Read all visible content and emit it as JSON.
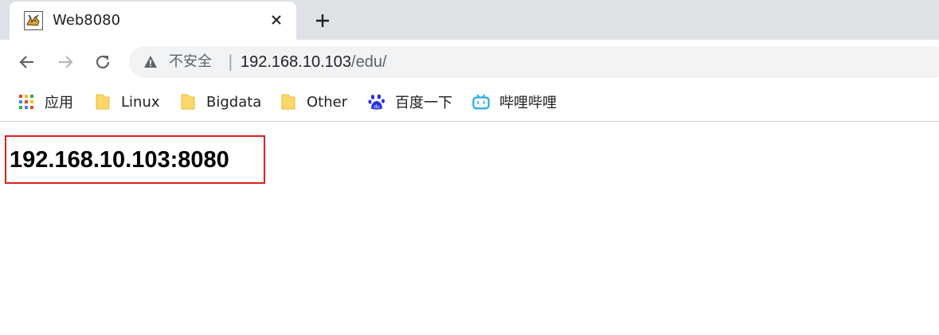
{
  "tab": {
    "title": "Web8080",
    "favicon": "tomcat-icon"
  },
  "new_tab_symbol": "+",
  "toolbar": {
    "security_status": "不安全",
    "separator": "|",
    "url_host": "192.168.10.103",
    "url_path": "/edu/"
  },
  "bookmarks": [
    {
      "label": "应用",
      "icon": "apps-grid-icon"
    },
    {
      "label": "Linux",
      "icon": "folder-icon"
    },
    {
      "label": "Bigdata",
      "icon": "folder-icon"
    },
    {
      "label": "Other",
      "icon": "folder-icon"
    },
    {
      "label": "百度一下",
      "icon": "baidu-paw-icon"
    },
    {
      "label": "哔哩哔哩",
      "icon": "bilibili-icon"
    }
  ],
  "page": {
    "heading": "192.168.10.103:8080"
  },
  "colors": {
    "tabstrip": "#dee1e6",
    "omnibox": "#f1f3f4",
    "highlight_border": "#e0201e",
    "folder": "#fcd76a",
    "baidu": "#2932e1",
    "bilibili": "#23ade5"
  }
}
